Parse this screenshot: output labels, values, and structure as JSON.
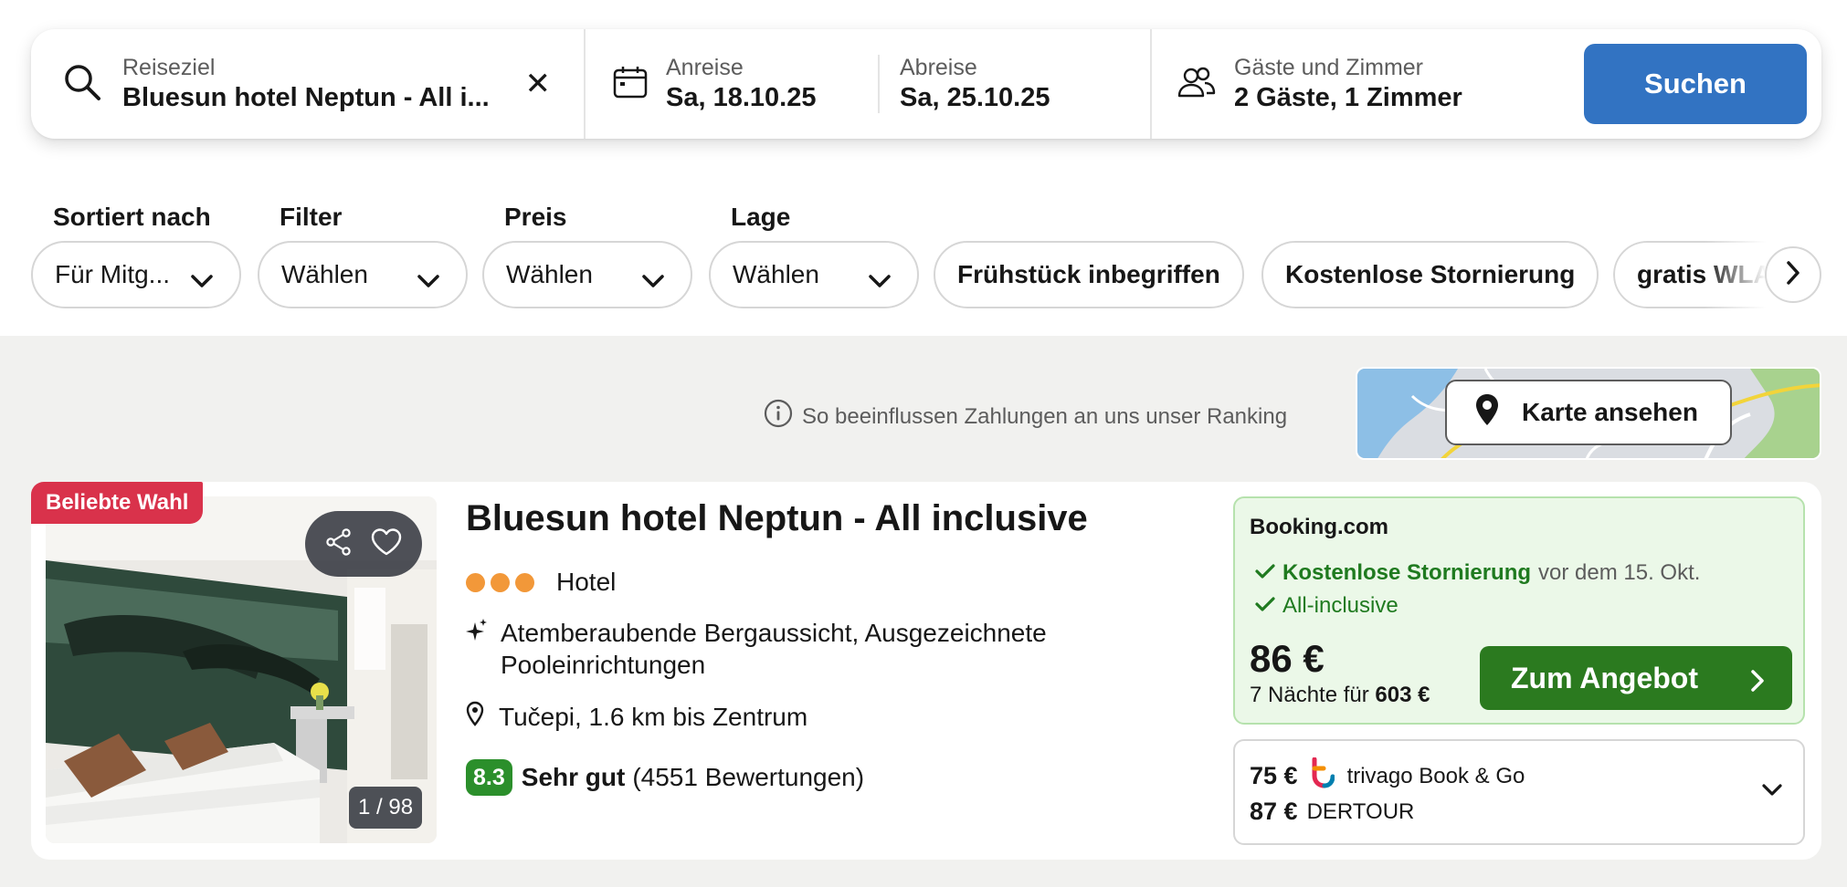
{
  "search": {
    "destination_label": "Reiseziel",
    "destination_value": "Bluesun hotel Neptun - All i...",
    "clear_icon": "close-icon",
    "checkin_label": "Anreise",
    "checkin_value": "Sa, 18.10.25",
    "checkout_label": "Abreise",
    "checkout_value": "Sa, 25.10.25",
    "guests_label": "Gäste und Zimmer",
    "guests_value": "2 Gäste, 1 Zimmer",
    "search_button": "Suchen"
  },
  "filters": {
    "sort_label": "Sortiert nach",
    "sort_value": "Für Mitg...",
    "filter_label": "Filter",
    "filter_value": "Wählen",
    "price_label": "Preis",
    "price_value": "Wählen",
    "location_label": "Lage",
    "location_value": "Wählen",
    "chips": [
      "Frühstück inbegriffen",
      "Kostenlose Stornierung",
      "gratis WLAN"
    ]
  },
  "results": {
    "ranking_info": "So beeinflussen Zahlungen an uns unser Ranking",
    "map_button": "Karte ansehen"
  },
  "hotel": {
    "badge": "Beliebte Wahl",
    "photo_counter": "1 / 98",
    "name": "Bluesun hotel Neptun - All inclusive",
    "star_count": 3,
    "type": "Hotel",
    "highlights": "Atemberaubende Bergaussicht, Ausgezeichnete Pooleinrichtungen",
    "location": "Tučepi, 1.6 km bis Zentrum",
    "score": "8.3",
    "rating_word": "Sehr gut",
    "reviews": "(4551 Bewertungen)"
  },
  "deal": {
    "provider": "Booking.com",
    "cancellation_bold": "Kostenlose Stornierung",
    "cancellation_rest": "vor dem 15. Okt.",
    "board": "All-inclusive",
    "price": "86 €",
    "total_prefix": "7 Nächte für",
    "total_value": "603 €",
    "cta": "Zum Angebot"
  },
  "other_offers": [
    {
      "price": "75 €",
      "provider": "trivago Book & Go"
    },
    {
      "price": "87 €",
      "provider": "DERTOUR"
    }
  ],
  "colors": {
    "primary_blue": "#3273c2",
    "deal_green": "#2b7a1f",
    "badge_red": "#d9324b",
    "score_green": "#2b8f2b",
    "star_orange": "#f29839"
  }
}
